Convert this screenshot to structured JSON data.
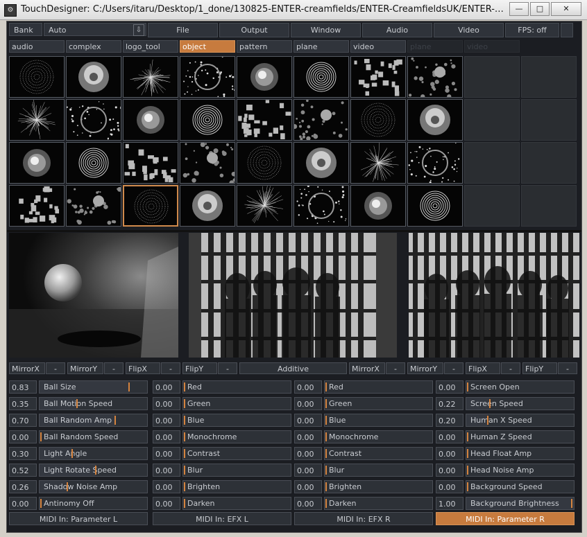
{
  "window": {
    "title": "TouchDesigner: C:/Users/itaru/Desktop/1_done/130825-ENTER-creamfields/ENTER-CreamfieldsUK/ENTER-Creamfie...",
    "icon": "td-app-icon",
    "minimize": "—",
    "maximize": "□",
    "close": "✕"
  },
  "menubar": {
    "bank_label": "Bank",
    "bank_value": "Auto",
    "bank_arrow": "⇩",
    "items": [
      {
        "label": "File"
      },
      {
        "label": "Output"
      },
      {
        "label": "Window"
      },
      {
        "label": "Audio"
      },
      {
        "label": "Video"
      },
      {
        "label": "FPS: off"
      }
    ]
  },
  "tabs": [
    {
      "label": "audio",
      "state": "normal"
    },
    {
      "label": "complex",
      "state": "normal"
    },
    {
      "label": "logo_tool",
      "state": "normal"
    },
    {
      "label": "object",
      "state": "active"
    },
    {
      "label": "pattern",
      "state": "normal"
    },
    {
      "label": "plane",
      "state": "normal"
    },
    {
      "label": "video",
      "state": "normal"
    },
    {
      "label": "plane",
      "state": "dim"
    },
    {
      "label": "video",
      "state": "dim"
    }
  ],
  "thumbnails": {
    "selected_index": 26,
    "accent_color": "#c77b3e"
  },
  "output_controls": [
    {
      "label": "MirrorX",
      "value": "-"
    },
    {
      "label": "MirrorY",
      "value": "-"
    },
    {
      "label": "FlipX",
      "value": "-"
    },
    {
      "label": "FlipY",
      "value": "-"
    },
    {
      "label": "Additive"
    },
    {
      "label": "MirrorX",
      "value": "-"
    },
    {
      "label": "MirrorY",
      "value": "-"
    },
    {
      "label": "FlipX",
      "value": "-"
    },
    {
      "label": "FlipY",
      "value": "-"
    }
  ],
  "param_columns": [
    [
      {
        "value": "0.83",
        "label": "Ball Size",
        "level": 0.83
      },
      {
        "value": "0.35",
        "label": "Ball Motion Speed",
        "level": 0.35
      },
      {
        "value": "0.70",
        "label": "Ball Random Amp",
        "level": 0.7
      },
      {
        "value": "0.00",
        "label": "Ball Random Speed",
        "level": 0.0
      },
      {
        "value": "0.30",
        "label": "Light Angle",
        "level": 0.3
      },
      {
        "value": "0.52",
        "label": "Light Rotate Speed",
        "level": 0.52
      },
      {
        "value": "0.26",
        "label": "Shadow Noise Amp",
        "level": 0.26
      },
      {
        "value": "0.00",
        "label": "Antinomy Off",
        "level": 0.0
      }
    ],
    [
      {
        "value": "0.00",
        "label": "Red",
        "level": 0.0
      },
      {
        "value": "0.00",
        "label": "Green",
        "level": 0.0
      },
      {
        "value": "0.00",
        "label": "Blue",
        "level": 0.0
      },
      {
        "value": "0.00",
        "label": "Monochrome",
        "level": 0.0
      },
      {
        "value": "0.00",
        "label": "Contrast",
        "level": 0.0
      },
      {
        "value": "0.00",
        "label": "Blur",
        "level": 0.0
      },
      {
        "value": "0.00",
        "label": "Brighten",
        "level": 0.0
      },
      {
        "value": "0.00",
        "label": "Darken",
        "level": 0.0
      }
    ],
    [
      {
        "value": "0.00",
        "label": "Red",
        "level": 0.0
      },
      {
        "value": "0.00",
        "label": "Green",
        "level": 0.0
      },
      {
        "value": "0.00",
        "label": "Blue",
        "level": 0.0
      },
      {
        "value": "0.00",
        "label": "Monochrome",
        "level": 0.0
      },
      {
        "value": "0.00",
        "label": "Contrast",
        "level": 0.0
      },
      {
        "value": "0.00",
        "label": "Blur",
        "level": 0.0
      },
      {
        "value": "0.00",
        "label": "Brighten",
        "level": 0.0
      },
      {
        "value": "0.00",
        "label": "Darken",
        "level": 0.0
      }
    ],
    [
      {
        "value": "0.00",
        "label": "Screen Open",
        "level": 0.0
      },
      {
        "value": "0.22",
        "label": "Screen Speed",
        "level": 0.22
      },
      {
        "value": "0.20",
        "label": "Human X Speed",
        "level": 0.2
      },
      {
        "value": "0.00",
        "label": "Human Z Speed",
        "level": 0.0
      },
      {
        "value": "0.00",
        "label": "Head Float Amp",
        "level": 0.0
      },
      {
        "value": "0.00",
        "label": "Head Noise Amp",
        "level": 0.0
      },
      {
        "value": "0.00",
        "label": "Background Speed",
        "level": 0.0
      },
      {
        "value": "1.00",
        "label": "Background Brightness",
        "level": 1.0
      }
    ]
  ],
  "midi": [
    {
      "label": "MIDI In: Parameter L",
      "active": false
    },
    {
      "label": "MIDI In: EFX L",
      "active": false
    },
    {
      "label": "MIDI In: EFX R",
      "active": false
    },
    {
      "label": "MIDI In: Parameter R",
      "active": true
    }
  ]
}
